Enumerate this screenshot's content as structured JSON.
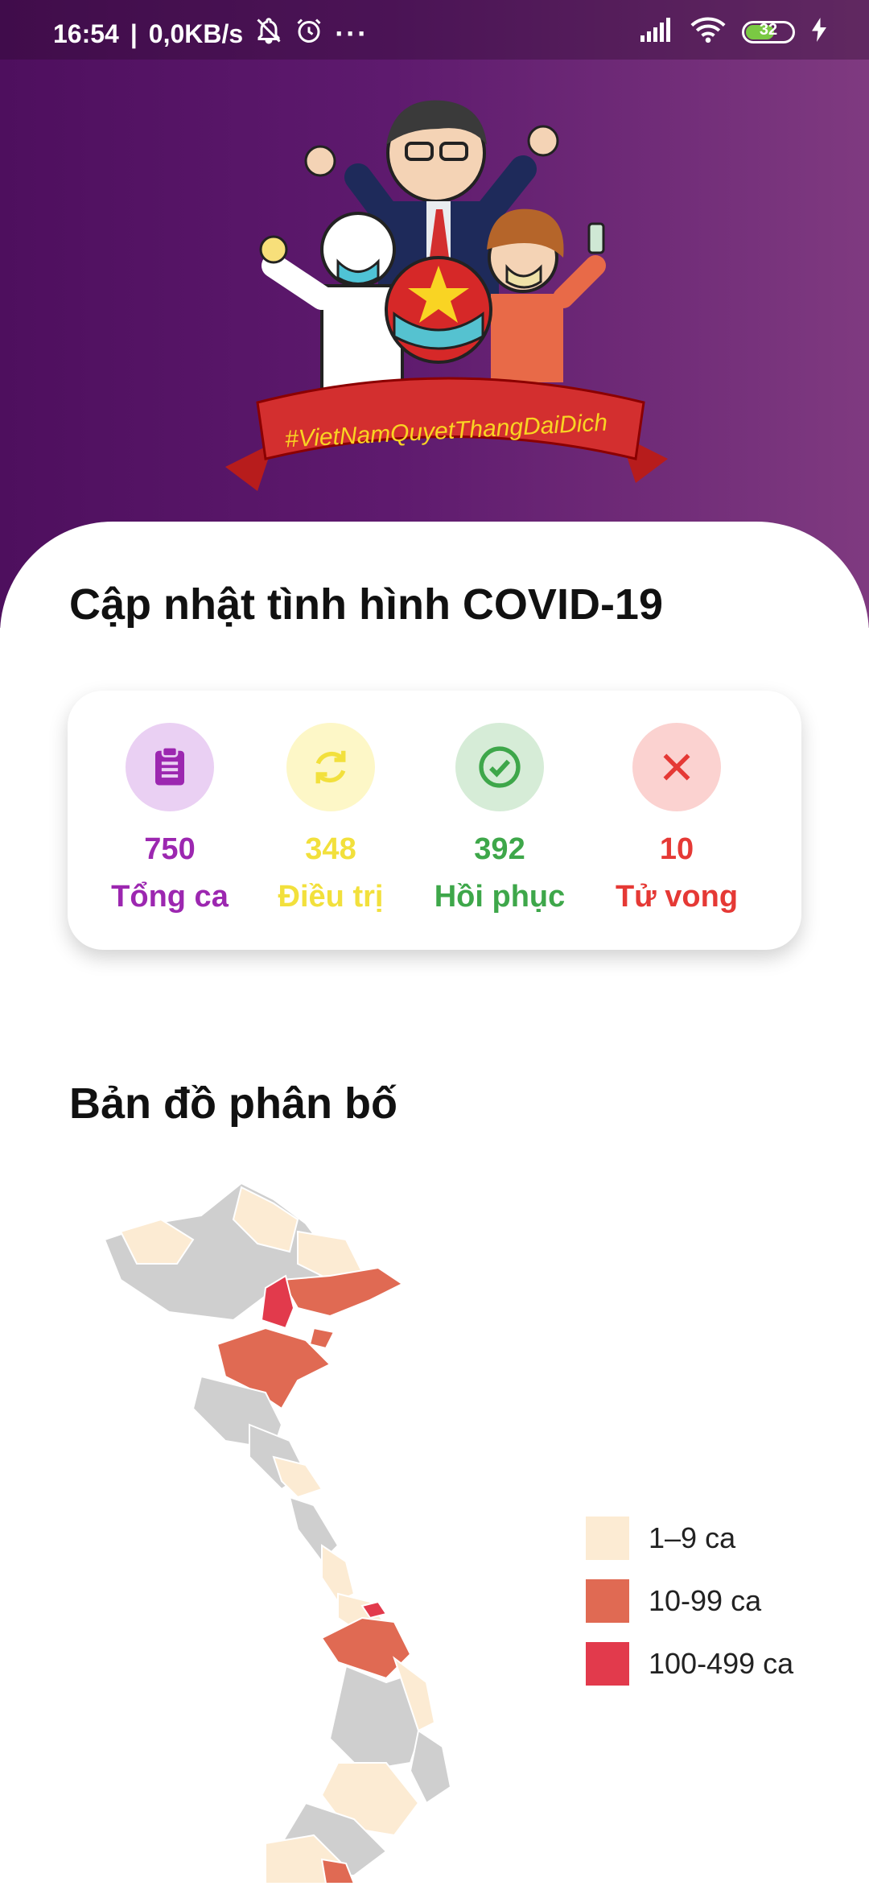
{
  "status_bar": {
    "time": "16:54",
    "network_speed": "0,0KB/s",
    "battery": "32",
    "mute_icon": "bell-off-icon",
    "alarm_icon": "alarm-icon",
    "more_icon": "more-dots-icon",
    "signal_icon": "signal-icon",
    "wifi_icon": "wifi-icon",
    "charging_icon": "bolt-icon"
  },
  "banner": {
    "hashtag": "#VietNamQuyetThangDaiDich"
  },
  "main": {
    "title": "Cập nhật tình hình COVID-19",
    "stats": [
      {
        "value": "750",
        "label": "Tổng ca",
        "icon": "clipboard-icon",
        "color": "#9c27b0",
        "bg": "#ead0f3"
      },
      {
        "value": "348",
        "label": "Điều trị",
        "icon": "refresh-icon",
        "color": "#f2e03c",
        "bg": "#fdf7c7"
      },
      {
        "value": "392",
        "label": "Hồi phục",
        "icon": "check-circle-icon",
        "color": "#3ea74a",
        "bg": "#d6ecd7"
      },
      {
        "value": "10",
        "label": "Tử vong",
        "icon": "close-icon",
        "color": "#e53935",
        "bg": "#fbd2d0"
      }
    ]
  },
  "map_section": {
    "title": "Bản đồ phân bố",
    "legend": [
      {
        "label": "1–9 ca",
        "color": "#fcebd3"
      },
      {
        "label": "10-99 ca",
        "color": "#e06a53"
      },
      {
        "label": "100-499 ca",
        "color": "#e23a4c"
      }
    ],
    "no_case_color": "#cfcfcf"
  }
}
